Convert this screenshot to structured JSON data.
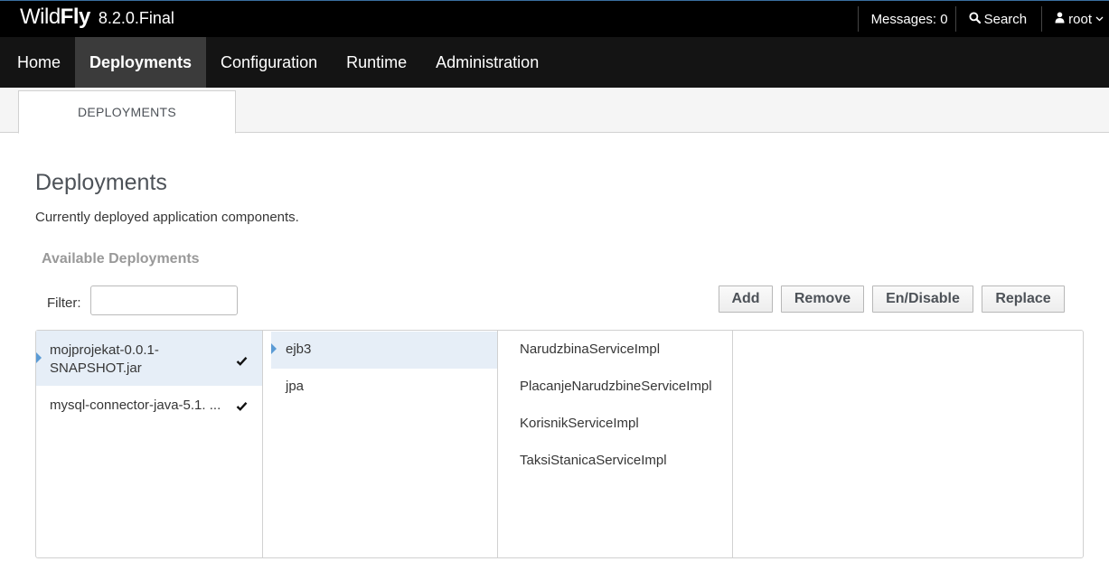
{
  "header": {
    "brand_light": "Wild",
    "brand_bold": "Fly",
    "version": "8.2.0.Final",
    "messages_label": "Messages: 0",
    "search_label": "Search",
    "user_label": "root"
  },
  "nav": {
    "items": [
      {
        "label": "Home"
      },
      {
        "label": "Deployments"
      },
      {
        "label": "Configuration"
      },
      {
        "label": "Runtime"
      },
      {
        "label": "Administration"
      }
    ]
  },
  "subtabs": {
    "deployments": "DEPLOYMENTS"
  },
  "content": {
    "title": "Deployments",
    "description": "Currently deployed application components.",
    "section_title": "Available Deployments",
    "filter_label": "Filter:",
    "filter_value": "",
    "buttons": {
      "add": "Add",
      "remove": "Remove",
      "endisable": "En/Disable",
      "replace": "Replace"
    }
  },
  "finder": {
    "deployments": [
      {
        "name": "mojprojekat-0.0.1-SNAPSHOT.jar",
        "enabled": true
      },
      {
        "name": "mysql-connector-java-5.1.",
        "enabled": true
      }
    ],
    "subsystems": [
      {
        "name": "ejb3"
      },
      {
        "name": "jpa"
      }
    ],
    "components": [
      {
        "name": "NarudzbinaServiceImpl"
      },
      {
        "name": "PlacanjeNarudzbineServiceImpl"
      },
      {
        "name": "KorisnikServiceImpl"
      },
      {
        "name": "TaksiStanicaServiceImpl"
      }
    ]
  },
  "colors": {
    "topbar": "#000000",
    "nav": "#141414",
    "nav_active": "#3b3b3b",
    "selection": "#e6eef7",
    "marker": "#5b9bd5"
  }
}
